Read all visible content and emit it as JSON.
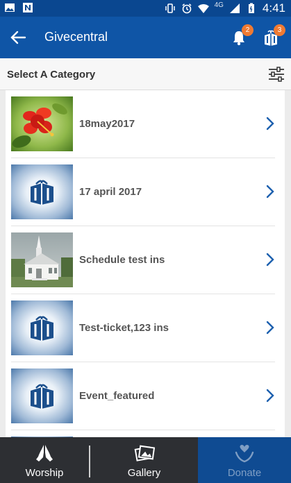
{
  "status_bar": {
    "time": "4:41",
    "network": "4G"
  },
  "app_bar": {
    "title": "Givecentral",
    "notification_count": "2",
    "gift_count": "3"
  },
  "category_header": {
    "title": "Select A Category"
  },
  "categories": [
    {
      "label": "18may2017",
      "thumb": "flower-photo"
    },
    {
      "label": "17 april 2017",
      "thumb": "givecentral-logo"
    },
    {
      "label": "Schedule test ins",
      "thumb": "church-photo"
    },
    {
      "label": "Test-ticket,123 ins",
      "thumb": "givecentral-logo"
    },
    {
      "label": "Event_featured",
      "thumb": "givecentral-logo"
    }
  ],
  "bottom_nav": [
    {
      "label": "Worship",
      "icon": "praying-hands-icon"
    },
    {
      "label": "Gallery",
      "icon": "gallery-icon"
    },
    {
      "label": "Donate",
      "icon": "heart-hand-icon",
      "active": true
    }
  ],
  "colors": {
    "app_bar": "#0f55a6",
    "status_bar": "#0a4790",
    "badge": "#f07a32",
    "chevron": "#1b5fae",
    "bottom_nav": "#2d2f33",
    "bottom_nav_active": "#0f4b92"
  }
}
